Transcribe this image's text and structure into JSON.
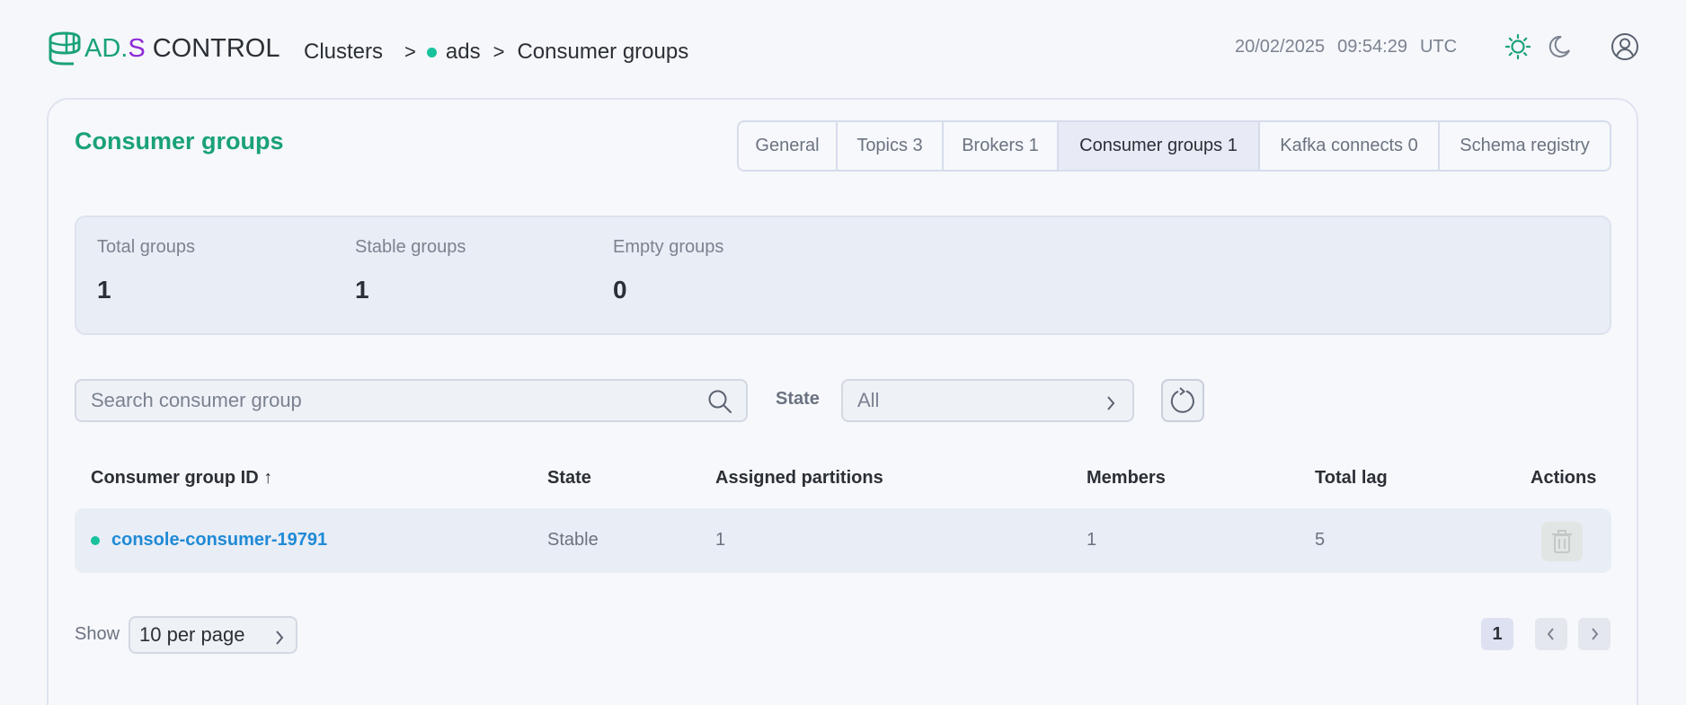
{
  "header": {
    "logo": {
      "ad": "AD.",
      "s": "S",
      "control": "CONTROL"
    },
    "breadcrumb": {
      "clusters": "Clusters",
      "sep": ">",
      "cluster": "ads",
      "current": "Consumer groups"
    },
    "datetime": {
      "date": "20/02/2025",
      "time": "09:54:29",
      "tz": "UTC"
    },
    "icons": [
      "sun-icon",
      "moon-icon",
      "user-icon"
    ]
  },
  "page": {
    "title": "Consumer groups"
  },
  "tabs": [
    {
      "label": "General"
    },
    {
      "label": "Topics 3"
    },
    {
      "label": "Brokers 1"
    },
    {
      "label": "Consumer groups 1",
      "active": true
    },
    {
      "label": "Kafka connects 0"
    },
    {
      "label": "Schema registry"
    }
  ],
  "stats": [
    {
      "label": "Total groups",
      "value": "1"
    },
    {
      "label": "Stable groups",
      "value": "1"
    },
    {
      "label": "Empty groups",
      "value": "0"
    }
  ],
  "filters": {
    "search_placeholder": "Search consumer group",
    "state_label": "State",
    "state_value": "All"
  },
  "table": {
    "columns": [
      "Consumer group ID ↑",
      "State",
      "Assigned partitions",
      "Members",
      "Total lag",
      "Actions"
    ],
    "rows": [
      {
        "id": "console-consumer-19791",
        "state": "Stable",
        "assigned_partitions": "1",
        "members": "1",
        "total_lag": "5"
      }
    ]
  },
  "pagination": {
    "show_label": "Show",
    "per_page": "10 per page",
    "current_page": "1"
  },
  "colors": {
    "accent": "#1aa17a",
    "status_stable": "#18c29c",
    "link": "#1f8ad6",
    "brand_s": "#8e2bd6"
  }
}
